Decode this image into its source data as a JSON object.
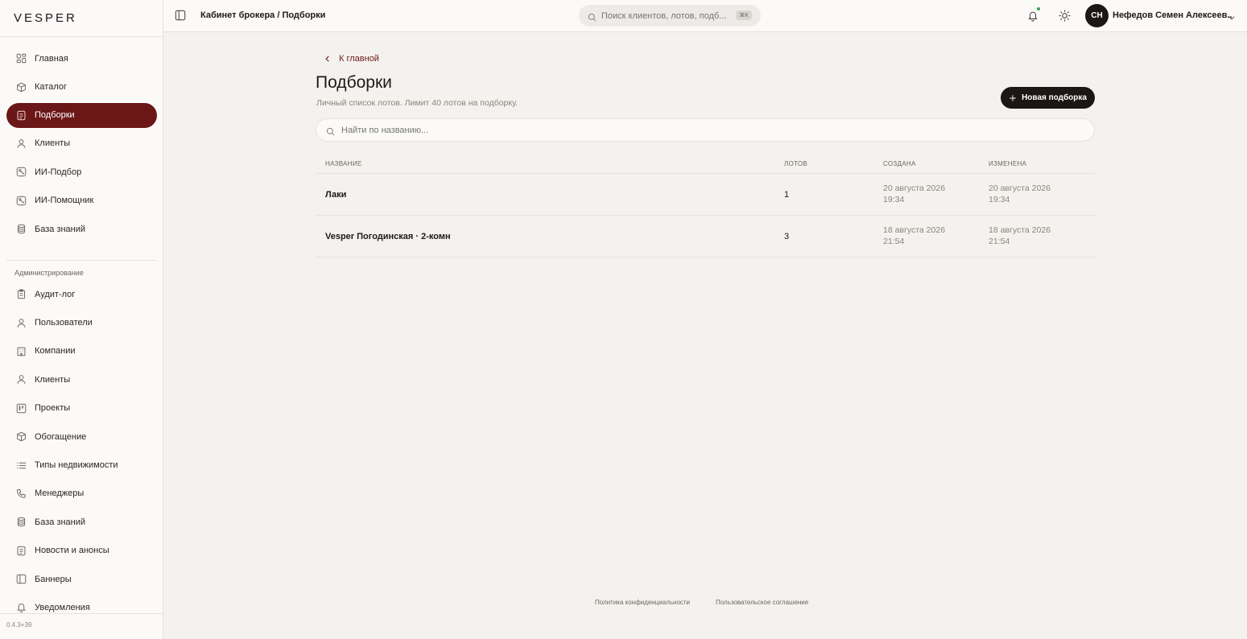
{
  "app": {
    "logo": "VESPER",
    "version": "0.4.3+39"
  },
  "sidebar": {
    "items": [
      {
        "label": "Главная",
        "icon": "dashboard-icon"
      },
      {
        "label": "Каталог",
        "icon": "box-icon"
      },
      {
        "label": "Подборки",
        "icon": "document-icon",
        "active": true
      },
      {
        "label": "Клиенты",
        "icon": "user-icon"
      },
      {
        "label": "ИИ-Подбор",
        "icon": "ai-icon"
      },
      {
        "label": "ИИ-Помощник",
        "icon": "ai-icon"
      },
      {
        "label": "База знаний",
        "icon": "database-icon"
      }
    ],
    "admin_title": "Администрирование",
    "admin_items": [
      {
        "label": "Аудит-лог",
        "icon": "clipboard-icon"
      },
      {
        "label": "Пользователи",
        "icon": "user-icon"
      },
      {
        "label": "Компании",
        "icon": "building-icon"
      },
      {
        "label": "Клиенты",
        "icon": "user-icon"
      },
      {
        "label": "Проекты",
        "icon": "kanban-icon"
      },
      {
        "label": "Обогащение",
        "icon": "box-icon"
      },
      {
        "label": "Типы недвижимости",
        "icon": "list-icon"
      },
      {
        "label": "Менеджеры",
        "icon": "phone-icon"
      },
      {
        "label": "База знаний",
        "icon": "database-icon"
      },
      {
        "label": "Новости и анонсы",
        "icon": "document-icon"
      },
      {
        "label": "Баннеры",
        "icon": "panel-icon"
      },
      {
        "label": "Уведомления",
        "icon": "bell-icon"
      }
    ]
  },
  "topbar": {
    "breadcrumb": "Кабинет брокера / Подборки",
    "search_placeholder": "Поиск клиентов, лотов, подб...",
    "shortcut": "⌘K",
    "avatar_initials": "СН",
    "user_name": "Нефедов Семен Алексеев..."
  },
  "main": {
    "back_label": "К главной",
    "title": "Подборки",
    "subtitle": "Личный список лотов. Лимит 40 лотов на подборку.",
    "new_button": "Новая подборка",
    "search_placeholder": "Найти по названию...",
    "table": {
      "headers": {
        "name": "НАЗВАНИЕ",
        "count": "ЛОТОВ",
        "created": "СОЗДАНА",
        "updated": "ИЗМЕНЕНА"
      },
      "rows": [
        {
          "name": "Лаки",
          "count": "1",
          "created_date": "20 августа 2026",
          "created_time": "19:34",
          "updated_date": "20 августа 2026",
          "updated_time": "19:34"
        },
        {
          "name": "Vesper Погодинская · 2-комн",
          "count": "3",
          "created_date": "18 августа 2026",
          "created_time": "21:54",
          "updated_date": "18 августа 2026",
          "updated_time": "21:54"
        }
      ]
    }
  },
  "footer": {
    "privacy": "Политика конфиденциальности",
    "terms": "Пользовательское соглашение"
  },
  "colors": {
    "accent": "#6b1718",
    "dark": "#1c1614",
    "background": "#f4f2ee"
  }
}
